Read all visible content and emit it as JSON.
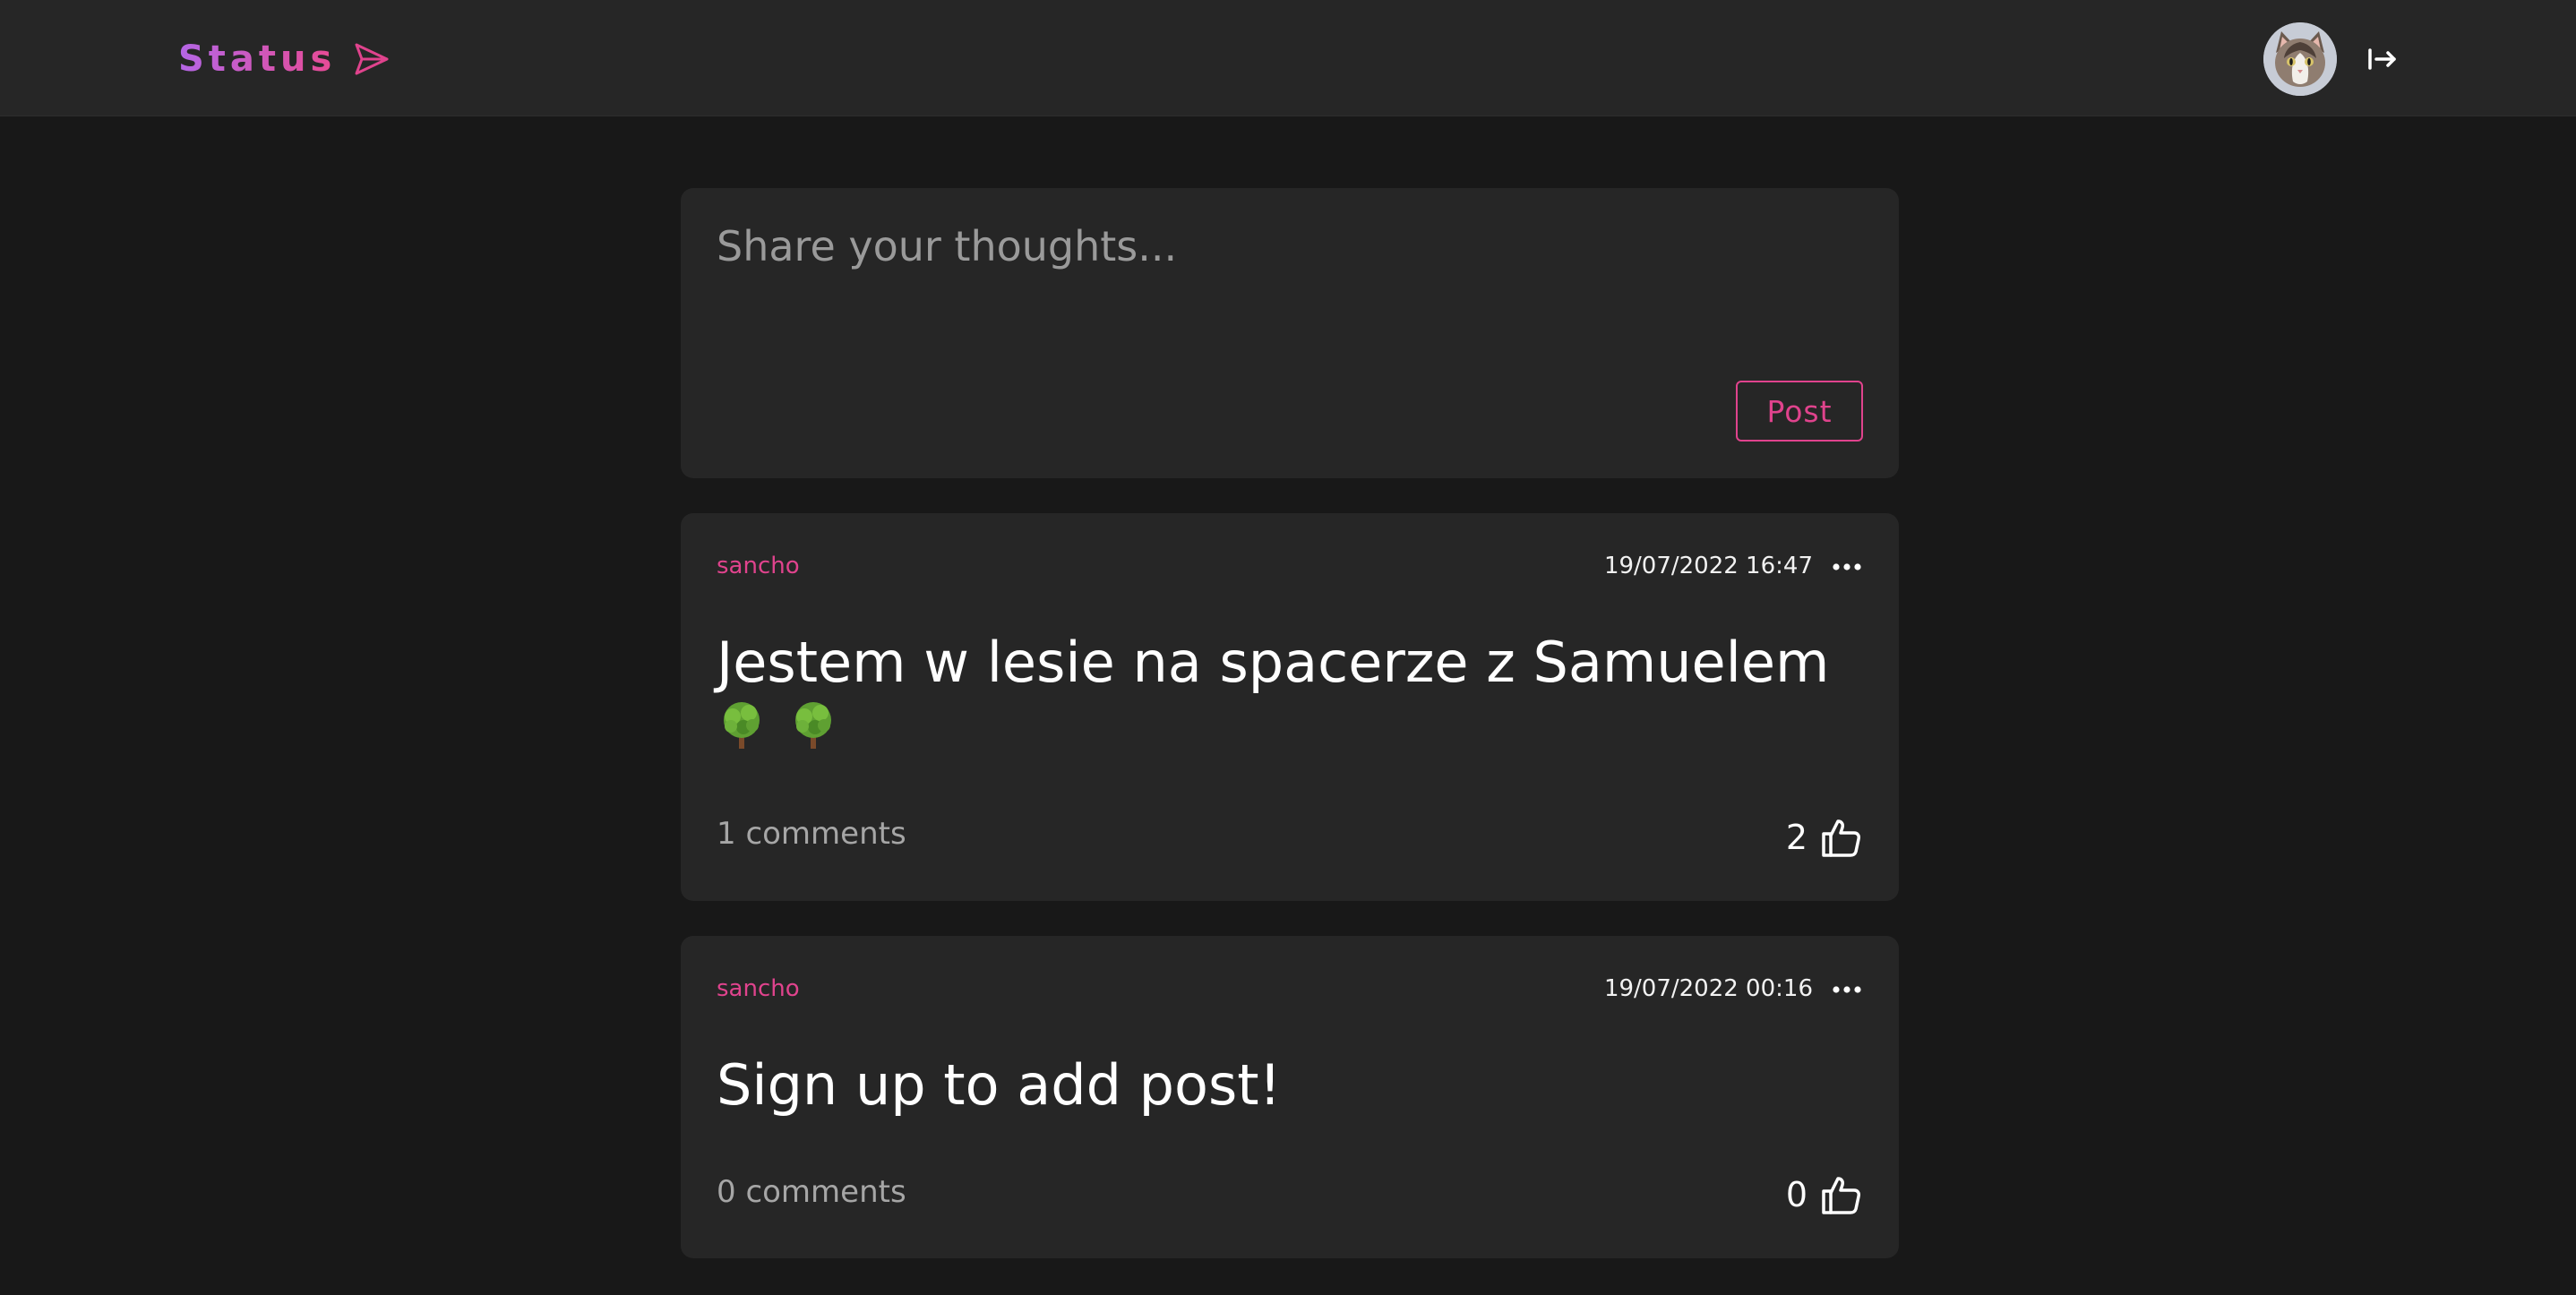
{
  "header": {
    "logo_text": "Status",
    "logo_icon": "paper-plane-icon",
    "avatar_icon": "user-avatar-cat",
    "logout_icon": "logout-icon",
    "accent_gradient": [
      "#b466e6",
      "#e84a93"
    ]
  },
  "composer": {
    "placeholder": "Share your thoughts...",
    "value": "",
    "post_label": "Post"
  },
  "posts": [
    {
      "author": "sancho",
      "date": "19/07/2022 16:47",
      "content": "Jestem w lesie na spacerze z Samuelem",
      "emoji": [
        "🌳",
        "🌳"
      ],
      "comments": "1 comments",
      "likes": "2"
    },
    {
      "author": "sancho",
      "date": "19/07/2022 00:16",
      "content": "Sign up to add post!",
      "emoji": [],
      "comments": "0 comments",
      "likes": "0"
    }
  ],
  "colors": {
    "background": "#181818",
    "card": "#262626",
    "accent": "#e0438d"
  }
}
